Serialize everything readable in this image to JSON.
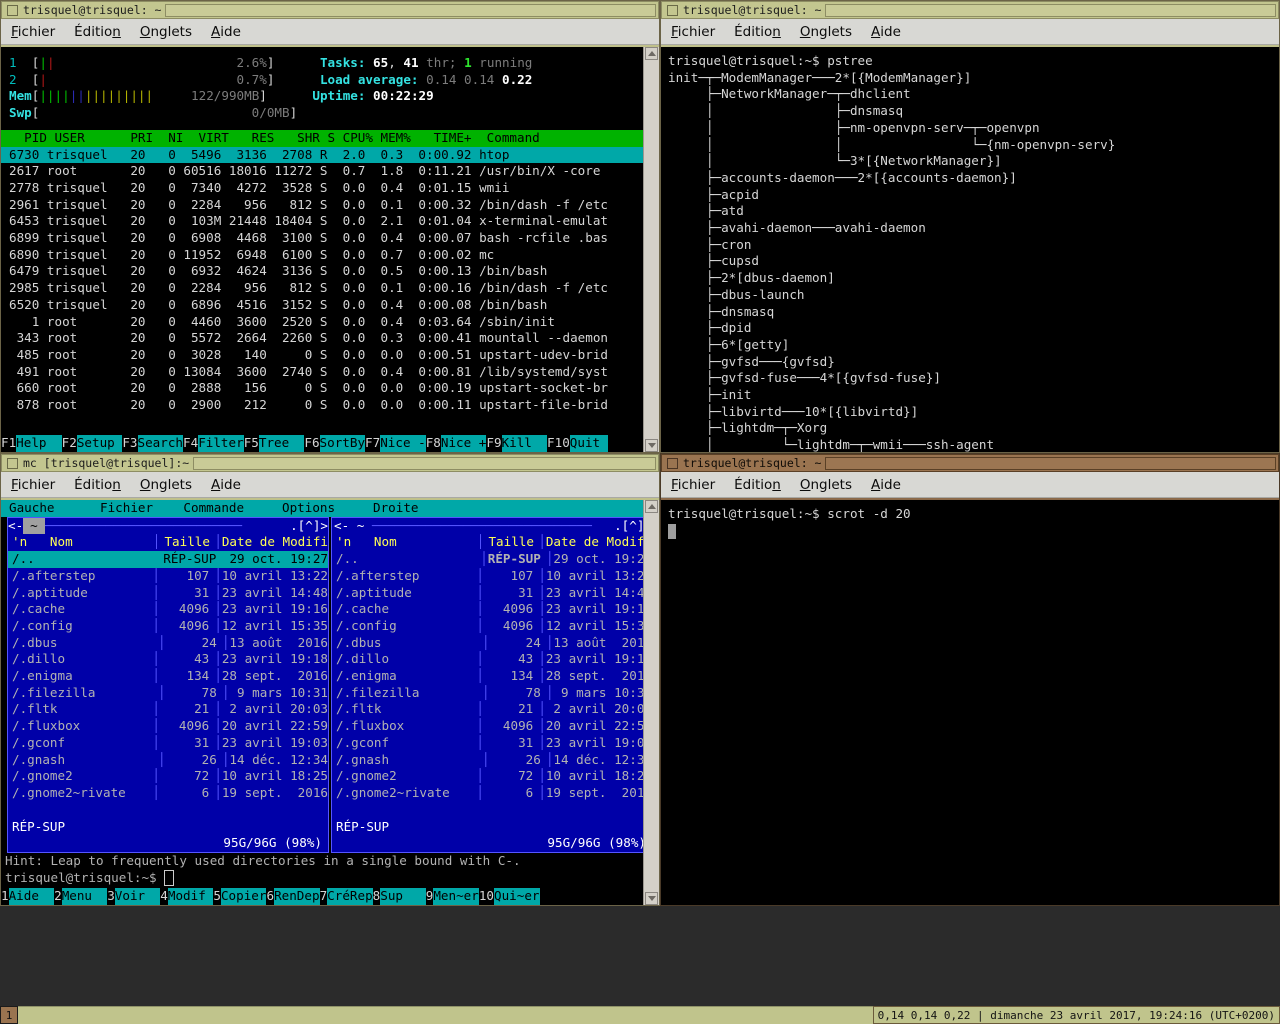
{
  "windows": {
    "htop": {
      "title": "trisquel@trisquel: ~",
      "menu": [
        "Fichier",
        "Édition",
        "Onglets",
        "Aide"
      ],
      "meters": {
        "cpu1_label": "1",
        "cpu1_value": "2.6%",
        "cpu2_label": "2",
        "cpu2_value": "0.7%",
        "mem_label": "Mem",
        "mem_value": "122/990MB",
        "swp_label": "Swp",
        "swp_value": "0/0MB",
        "tasks_label": "Tasks:",
        "tasks_total": "65",
        "tasks_thr": "41",
        "tasks_thr_word": "thr;",
        "tasks_running": "1",
        "tasks_running_word": "running",
        "load_label": "Load average:",
        "load1": "0.14",
        "load5": "0.14",
        "load15": "0.22",
        "uptime_label": "Uptime:",
        "uptime_value": "00:22:29"
      },
      "columns": [
        "PID",
        "USER",
        "PRI",
        "NI",
        "VIRT",
        "RES",
        "SHR",
        "S",
        "CPU%",
        "MEM%",
        "TIME+",
        "Command"
      ],
      "header_line": "  PID USER      PRI  NI  VIRT   RES   SHR S CPU% MEM%   TIME+  Command",
      "rows": [
        "6730 trisquel   20   0  5496  3136  2708 R  2.0  0.3  0:00.92 htop",
        "2617 root       20   0 60516 18016 11272 S  0.7  1.8  0:11.21 /usr/bin/X -core",
        "2778 trisquel   20   0  7340  4272  3528 S  0.0  0.4  0:01.15 wmii",
        "2961 trisquel   20   0  2284   956   812 S  0.0  0.1  0:00.32 /bin/dash -f /etc",
        "6453 trisquel   20   0  103M 21448 18404 S  0.0  2.1  0:01.04 x-terminal-emulat",
        "6899 trisquel   20   0  6908  4468  3100 S  0.0  0.4  0:00.07 bash -rcfile .bas",
        "6890 trisquel   20   0 11952  6948  6100 S  0.0  0.7  0:00.02 mc",
        "6479 trisquel   20   0  6932  4624  3136 S  0.0  0.5  0:00.13 /bin/bash",
        "2985 trisquel   20   0  2284   956   812 S  0.0  0.1  0:00.16 /bin/dash -f /etc",
        "6520 trisquel   20   0  6896  4516  3152 S  0.0  0.4  0:00.08 /bin/bash",
        "   1 root       20   0  4460  3600  2520 S  0.0  0.4  0:03.64 /sbin/init",
        " 343 root       20   0  5572  2664  2260 S  0.0  0.3  0:00.41 mountall --daemon",
        " 485 root       20   0  3028   140     0 S  0.0  0.0  0:00.51 upstart-udev-brid",
        " 491 root       20   0 13084  3600  2740 S  0.0  0.4  0:00.81 /lib/systemd/syst",
        " 660 root       20   0  2888   156     0 S  0.0  0.0  0:00.19 upstart-socket-br",
        " 878 root       20   0  2900   212     0 S  0.0  0.0  0:00.11 upstart-file-brid"
      ],
      "fkeys": [
        {
          "key": "F1",
          "label": "Help  "
        },
        {
          "key": "F2",
          "label": "Setup "
        },
        {
          "key": "F3",
          "label": "Search"
        },
        {
          "key": "F4",
          "label": "Filter"
        },
        {
          "key": "F5",
          "label": "Tree  "
        },
        {
          "key": "F6",
          "label": "SortBy"
        },
        {
          "key": "F7",
          "label": "Nice -"
        },
        {
          "key": "F8",
          "label": "Nice +"
        },
        {
          "key": "F9",
          "label": "Kill  "
        },
        {
          "key": "F10",
          "label": "Quit "
        }
      ]
    },
    "pstree": {
      "title": "trisquel@trisquel: ~",
      "menu": [
        "Fichier",
        "Édition",
        "Onglets",
        "Aide"
      ],
      "prompt": "trisquel@trisquel:~$ pstree",
      "tree": [
        "init─┬─ModemManager───2*[{ModemManager}]",
        "     ├─NetworkManager─┬─dhclient",
        "     │                ├─dnsmasq",
        "     │                ├─nm-openvpn-serv─┬─openvpn",
        "     │                │                 └─{nm-openvpn-serv}",
        "     │                └─3*[{NetworkManager}]",
        "     ├─accounts-daemon───2*[{accounts-daemon}]",
        "     ├─acpid",
        "     ├─atd",
        "     ├─avahi-daemon───avahi-daemon",
        "     ├─cron",
        "     ├─cupsd",
        "     ├─2*[dbus-daemon]",
        "     ├─dbus-launch",
        "     ├─dnsmasq",
        "     ├─dpid",
        "     ├─6*[getty]",
        "     ├─gvfsd───{gvfsd}",
        "     ├─gvfsd-fuse───4*[{gvfsd-fuse}]",
        "     ├─init",
        "     ├─libvirtd───10*[{libvirtd}]",
        "     ├─lightdm─┬─Xorg",
        "     │         └─lightdm─┬─wmii───ssh-agent"
      ]
    },
    "mc": {
      "title": "mc [trisquel@trisquel]:~",
      "menu": [
        "Fichier",
        "Édition",
        "Onglets",
        "Aide"
      ],
      "menubar_items": [
        "Gauche",
        "Fichier",
        "Commande",
        "Options",
        "Droite"
      ],
      "panel_tab": "~",
      "panel_path_left": "<- ~",
      "panel_path_right": "<- ~",
      "panel_corner": ".[^]>",
      "columns": [
        "'n   Nom",
        "Taille",
        "Date de Modifi"
      ],
      "files": [
        {
          "name": "/..",
          "size": "RÉP-SUP",
          "date": "29 oct. 19:27",
          "selected": true
        },
        {
          "name": "/.afterstep",
          "size": "107",
          "date": "10 avril 13:22",
          "selected": false
        },
        {
          "name": "/.aptitude",
          "size": "31",
          "date": "23 avril 14:48",
          "selected": false
        },
        {
          "name": "/.cache",
          "size": "4096",
          "date": "23 avril 19:16",
          "selected": false
        },
        {
          "name": "/.config",
          "size": "4096",
          "date": "12 avril 15:35",
          "selected": false
        },
        {
          "name": "/.dbus",
          "size": "24",
          "date": "13 août  2016",
          "selected": false
        },
        {
          "name": "/.dillo",
          "size": "43",
          "date": "23 avril 19:18",
          "selected": false
        },
        {
          "name": "/.enigma",
          "size": "134",
          "date": "28 sept.  2016",
          "selected": false
        },
        {
          "name": "/.filezilla",
          "size": "78",
          "date": " 9 mars 10:31",
          "selected": false
        },
        {
          "name": "/.fltk",
          "size": "21",
          "date": " 2 avril 20:03",
          "selected": false
        },
        {
          "name": "/.fluxbox",
          "size": "4096",
          "date": "20 avril 22:59",
          "selected": false
        },
        {
          "name": "/.gconf",
          "size": "31",
          "date": "23 avril 19:03",
          "selected": false
        },
        {
          "name": "/.gnash",
          "size": "26",
          "date": "14 déc. 12:34",
          "selected": false
        },
        {
          "name": "/.gnome2",
          "size": "72",
          "date": "10 avril 18:25",
          "selected": false
        },
        {
          "name": "/.gnome2~rivate",
          "size": "6",
          "date": "19 sept.  2016",
          "selected": false
        }
      ],
      "status_minitext": "RÉP-SUP",
      "disk_free": "95G/96G (98%)",
      "hint": "Hint: Leap to frequently used directories in a single bound with C-.",
      "shell_prompt": "trisquel@trisquel:~$",
      "fkeys": [
        {
          "key": "1",
          "label": "Aide  "
        },
        {
          "key": "2",
          "label": "Menu  "
        },
        {
          "key": "3",
          "label": "Voir  "
        },
        {
          "key": "4",
          "label": "Modif "
        },
        {
          "key": "5",
          "label": "Copier"
        },
        {
          "key": "6",
          "label": "RenDep"
        },
        {
          "key": "7",
          "label": "CréRep"
        },
        {
          "key": "8",
          "label": "Sup   "
        },
        {
          "key": "9",
          "label": "Men~er"
        },
        {
          "key": "10",
          "label": "Qui~er"
        }
      ]
    },
    "scrot": {
      "title": "trisquel@trisquel: ~",
      "menu": [
        "Fichier",
        "Édition",
        "Onglets",
        "Aide"
      ],
      "line": "trisquel@trisquel:~$ scrot -d 20"
    }
  },
  "taskbar": {
    "tag": "1",
    "status": "0,14 0,14 0,22 | dimanche 23 avril 2017, 19:24:16 (UTC+0200)"
  },
  "colors": {
    "frame_active": "#c3c68f",
    "frame_inactive": "#9a7450",
    "terminal_bg": "#000000",
    "terminal_fg": "#b2b2b2",
    "htop_header": "#00b200",
    "htop_select": "#00a8a8",
    "mc_panel": "#0000a8",
    "mc_menu": "#00a8a8",
    "taskbar_bg": "#c0c48c"
  }
}
